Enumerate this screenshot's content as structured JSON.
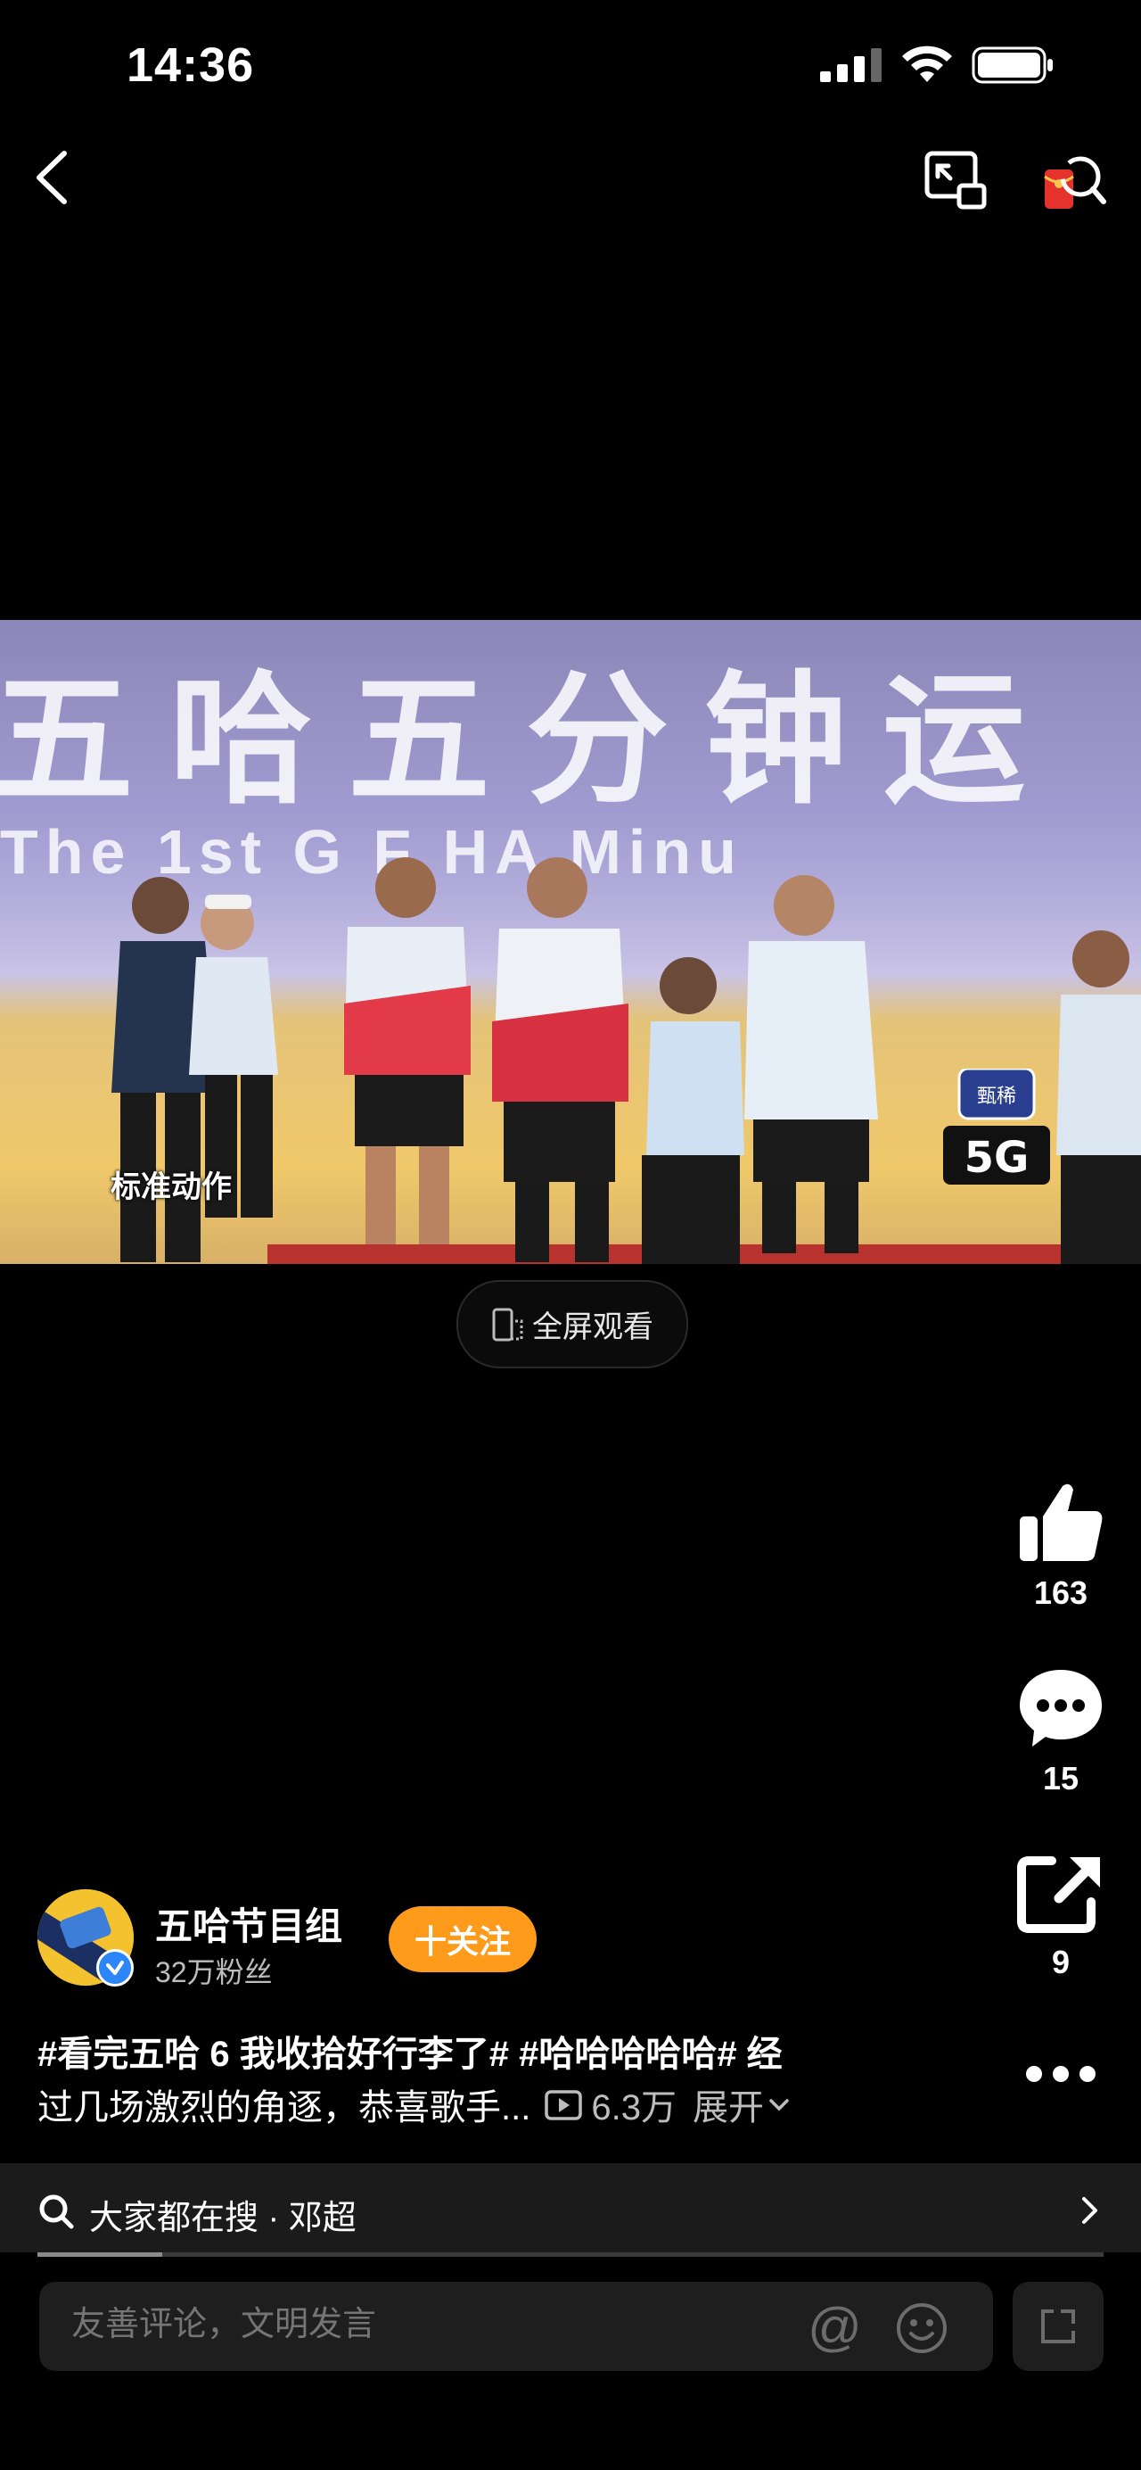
{
  "status_bar": {
    "time": "14:36"
  },
  "video": {
    "banner_cn": "五哈五分钟运",
    "banner_en": "The 1st G   F   HA   Minu",
    "caption": "标准动作",
    "logo_label": "甄稀 5G"
  },
  "fullscreen_button": {
    "label": "全屏观看"
  },
  "actions": {
    "like_count": "163",
    "comment_count": "15",
    "share_count": "9"
  },
  "author": {
    "name": "五哈节目组",
    "fans": "32万粉丝",
    "follow_label": "十关注"
  },
  "description": {
    "line1": "#看完五哈 6 我收拾好行李了# #哈哈哈哈哈# 经",
    "line2_text": "过几场激烈的角逐，恭喜歌手...",
    "views": "6.3万",
    "expand_label": "展开"
  },
  "search": {
    "label": "大家都在搜 · 邓超"
  },
  "comment": {
    "placeholder": "友善评论，文明发言"
  },
  "colors": {
    "follow_button": "#ff9b1a",
    "verified_badge": "#2c86f7",
    "background": "#000000"
  }
}
